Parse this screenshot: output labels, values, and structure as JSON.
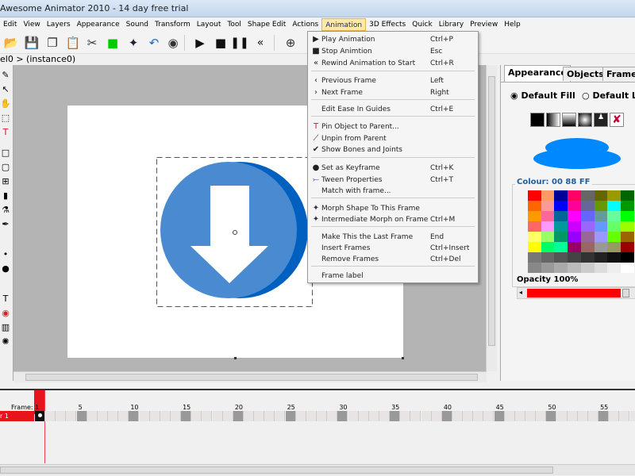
{
  "window": {
    "title": "Awesome Animator 2010 - 14 day free trial"
  },
  "menubar": [
    "Edit",
    "View",
    "Layers",
    "Appearance",
    "Sound",
    "Transform",
    "Layout",
    "Tool",
    "Shape Edit",
    "Actions",
    "Animation",
    "3D Effects",
    "Quick",
    "Library",
    "Preview",
    "Help"
  ],
  "active_menu": "Animation",
  "toolbar": [
    "open-folder-icon",
    "save-icon",
    "copy-icon",
    "paste-icon",
    "cut-icon",
    "colour-swap-icon",
    "morph-icon",
    "undo-icon",
    "preview-eye-icon",
    "play-icon",
    "stop-icon",
    "pause-icon",
    "rewind-icon",
    "zoom-icon"
  ],
  "breadcrumb": "el0 > (instance0)",
  "dropdown": {
    "items": [
      {
        "icon": "▶",
        "label": "Play Animation",
        "shortcut": "Ctrl+P"
      },
      {
        "icon": "■",
        "label": "Stop Animtion",
        "shortcut": "Esc"
      },
      {
        "icon": "«",
        "label": "Rewind Animation to Start",
        "shortcut": "Ctrl+R"
      },
      {
        "icon": "‹",
        "label": "Previous Frame",
        "shortcut": "Left"
      },
      {
        "icon": "›",
        "label": "Next Frame",
        "shortcut": "Right"
      },
      {
        "icon": "",
        "label": "Edit Ease In Guides",
        "shortcut": "Ctrl+E"
      },
      {
        "icon": "T",
        "label": "Pin Object to Parent...",
        "shortcut": ""
      },
      {
        "icon": "⟋",
        "label": "Unpin from Parent",
        "shortcut": ""
      },
      {
        "icon": "✔",
        "label": "Show Bones and Joints",
        "shortcut": ""
      },
      {
        "icon": "●",
        "label": "Set as Keyframe",
        "shortcut": "Ctrl+K"
      },
      {
        "icon": "⤚",
        "label": "Tween Properties",
        "shortcut": "Ctrl+T"
      },
      {
        "icon": "",
        "label": "Match with frame...",
        "shortcut": ""
      },
      {
        "icon": "✦",
        "label": "Morph Shape To This Frame",
        "shortcut": ""
      },
      {
        "icon": "✦",
        "label": "Intermediate Morph on Frame",
        "shortcut": "Ctrl+M"
      },
      {
        "icon": "",
        "label": "Make This the Last Frame",
        "shortcut": "End"
      },
      {
        "icon": "",
        "label": "Insert Frames",
        "shortcut": "Ctrl+Insert"
      },
      {
        "icon": "",
        "label": "Remove Frames",
        "shortcut": "Ctrl+Del"
      },
      {
        "icon": "",
        "label": "Frame label",
        "shortcut": ""
      }
    ]
  },
  "panel": {
    "tabs": [
      "Appearance",
      "Objects",
      "Frame"
    ],
    "fill_option": "Default Fill",
    "line_option": "Default Lin",
    "colour_label": "Colour: 00 88 FF",
    "current_colour": "#0088ff",
    "opacity_label": "Opacity 100%",
    "opacity": 100,
    "palette": [
      "#ff0000",
      "#ff9966",
      "#000099",
      "#ff0066",
      "#666666",
      "#666600",
      "#999900",
      "#006600",
      "#ff6600",
      "#ff9999",
      "#0000ff",
      "#ff0099",
      "#666699",
      "#669900",
      "#00ffff",
      "#009900",
      "#ff9900",
      "#ff6699",
      "#006699",
      "#ff00ff",
      "#6666ff",
      "#669999",
      "#66ff99",
      "#00ff00",
      "#ff6666",
      "#ff99ff",
      "#009999",
      "#cc00ff",
      "#9966ff",
      "#6699ff",
      "#66ff66",
      "#99ff00",
      "#ffff66",
      "#99ff66",
      "#009966",
      "#9900ff",
      "#996699",
      "#9999ff",
      "#66ff00",
      "#996600",
      "#ffff00",
      "#00ff66",
      "#00ff99",
      "#990066",
      "#996666",
      "#999999",
      "#999966",
      "#990000",
      "#777777",
      "#666666",
      "#555555",
      "#444444",
      "#333333",
      "#222222",
      "#111111",
      "#000000",
      "#888888",
      "#999999",
      "#aaaaaa",
      "#bbbbbb",
      "#cccccc",
      "#dddddd",
      "#eeeeee",
      "#ffffff"
    ]
  },
  "timeline": {
    "frame_label": "Frame: 1",
    "layer_name": "r 1",
    "current_frame": 1,
    "numbers": [
      "5",
      "10",
      "15",
      "20",
      "25",
      "30",
      "35",
      "40",
      "45",
      "50",
      "55"
    ]
  }
}
